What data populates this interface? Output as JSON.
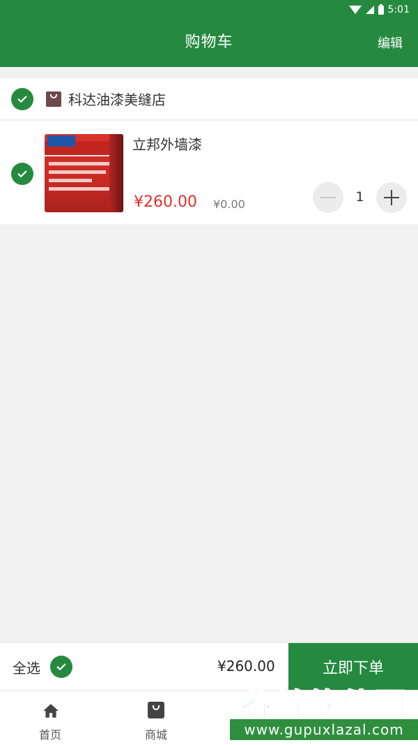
{
  "status_bar": {
    "time": "5:01"
  },
  "header": {
    "title": "购物车",
    "edit_label": "编辑"
  },
  "shop": {
    "name": "科达油漆美缝店",
    "checked": true
  },
  "items": [
    {
      "name": "立邦外墙漆",
      "price": "¥260.00",
      "old_price": "¥0.00",
      "quantity": "1",
      "checked": true
    }
  ],
  "checkout": {
    "select_all_label": "全选",
    "total": "¥260.00",
    "order_label": "立即下单"
  },
  "tabbar": {
    "home_label": "首页",
    "mall_label": "商城"
  },
  "watermark": {
    "brand": "谷普软件园",
    "url": "www.gupuxlazal.com"
  },
  "colors": {
    "primary": "#258a3f",
    "price": "#e0302b",
    "background": "#f1f1f1"
  }
}
